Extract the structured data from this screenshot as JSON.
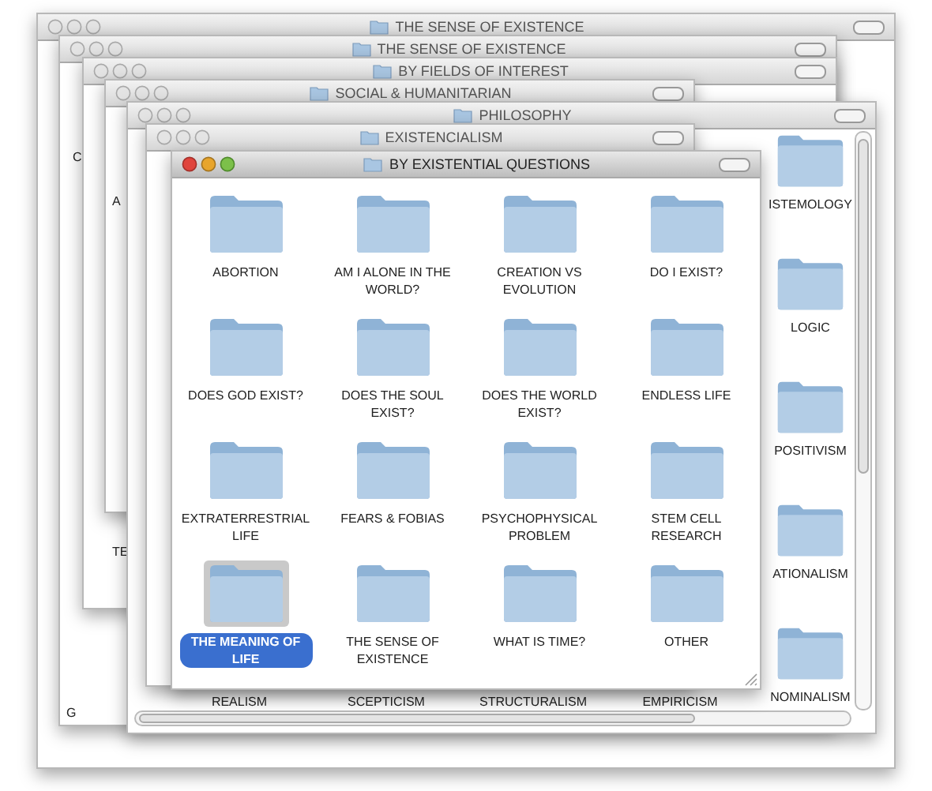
{
  "back_windows": [
    {
      "title": "THE SENSE OF EXISTENCE"
    },
    {
      "title": "THE SENSE OF EXISTENCE",
      "fragments": [
        "C",
        "G"
      ]
    },
    {
      "title": "BY FIELDS OF INTEREST",
      "fragments": [
        "TE"
      ]
    },
    {
      "title": "SOCIAL & HUMANITARIAN",
      "fragments": [
        "A"
      ]
    },
    {
      "title": "PHILOSOPHY"
    },
    {
      "title": "EXISTENCIALISM"
    }
  ],
  "philosophy": {
    "right_column": [
      "ISTEMOLOGY",
      "LOGIC",
      "POSITIVISM",
      "ATIONALISM",
      "NOMINALISM"
    ],
    "bottom_row": [
      "REALISM",
      "SCEPTICISM",
      "STRUCTURALISM",
      "EMPIRICISM"
    ]
  },
  "front": {
    "title": "BY EXISTENTIAL QUESTIONS",
    "items": [
      {
        "label": "ABORTION",
        "selected": false
      },
      {
        "label": "AM I ALONE IN THE WORLD?",
        "selected": false
      },
      {
        "label": "CREATION VS EVOLUTION",
        "selected": false
      },
      {
        "label": "DO I EXIST?",
        "selected": false
      },
      {
        "label": "DOES GOD EXIST?",
        "selected": false
      },
      {
        "label": "DOES THE SOUL EXIST?",
        "selected": false
      },
      {
        "label": "DOES THE WORLD EXIST?",
        "selected": false
      },
      {
        "label": "ENDLESS LIFE",
        "selected": false
      },
      {
        "label": "EXTRATERRESTRIAL LIFE",
        "selected": false
      },
      {
        "label": "FEARS & FOBIAS",
        "selected": false
      },
      {
        "label": "PSYCHOPHYSICAL PROBLEM",
        "selected": false
      },
      {
        "label": "STEM CELL RESEARCH",
        "selected": false
      },
      {
        "label": "THE MEANING OF LIFE",
        "selected": true
      },
      {
        "label": "THE SENSE OF EXISTENCE",
        "selected": false
      },
      {
        "label": "WHAT IS TIME?",
        "selected": false
      },
      {
        "label": "OTHER",
        "selected": false
      }
    ]
  }
}
